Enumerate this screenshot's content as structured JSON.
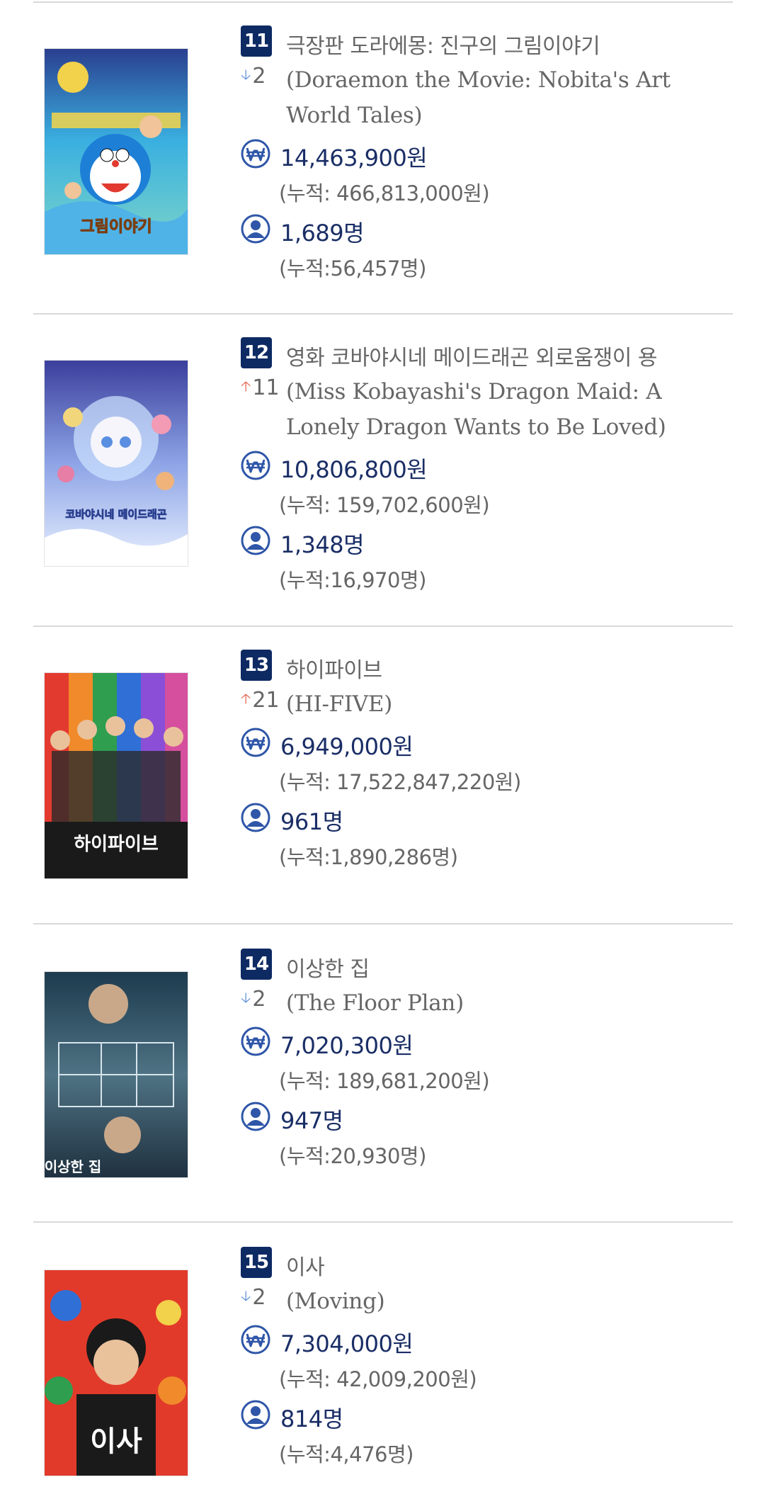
{
  "movies": [
    {
      "rank": "11",
      "trend": "down",
      "trend_value": "2",
      "title_ko": "극장판 도라에몽: 진구의 그림이야기",
      "title_en": "(Doraemon the Movie: Nobita's Art World Tales)",
      "revenue": "14,463,900원",
      "revenue_total": "(누적: 466,813,000원)",
      "audience": "1,689명",
      "audience_total": "(누적:56,457명)",
      "poster_text": "그림이야기"
    },
    {
      "rank": "12",
      "trend": "up",
      "trend_value": "11",
      "title_ko": "영화 코바야시네 메이드래곤 외로움쟁이 용",
      "title_en": "(Miss Kobayashi's Dragon Maid: A Lonely Dragon Wants to Be Loved)",
      "revenue": "10,806,800원",
      "revenue_total": "(누적: 159,702,600원)",
      "audience": "1,348명",
      "audience_total": "(누적:16,970명)",
      "poster_text": "코바야시네 메이드래곤"
    },
    {
      "rank": "13",
      "trend": "up",
      "trend_value": "21",
      "title_ko": "하이파이브",
      "title_en": "(HI-FIVE)",
      "revenue": "6,949,000원",
      "revenue_total": "(누적: 17,522,847,220원)",
      "audience": "961명",
      "audience_total": "(누적:1,890,286명)",
      "poster_text": "하이파이브"
    },
    {
      "rank": "14",
      "trend": "down",
      "trend_value": "2",
      "title_ko": "이상한 집",
      "title_en": "(The Floor Plan)",
      "revenue": "7,020,300원",
      "revenue_total": "(누적: 189,681,200원)",
      "audience": "947명",
      "audience_total": "(누적:20,930명)",
      "poster_text": "이상한 집"
    },
    {
      "rank": "15",
      "trend": "down",
      "trend_value": "2",
      "title_ko": "이사",
      "title_en": "(Moving)",
      "revenue": "7,304,000원",
      "revenue_total": "(누적: 42,009,200원)",
      "audience": "814명",
      "audience_total": "(누적:4,476명)",
      "poster_text": "이사"
    }
  ],
  "colors": {
    "rank_badge": "#0e2a63",
    "stat_text": "#1a2e66",
    "trend_down": "#5b8fd8",
    "trend_up": "#e5634d",
    "icon_blue": "#2f56a8"
  },
  "icons": {
    "revenue": "won-coin-icon",
    "audience": "person-icon",
    "trend_up": "arrow-up-icon",
    "trend_down": "arrow-down-icon"
  }
}
